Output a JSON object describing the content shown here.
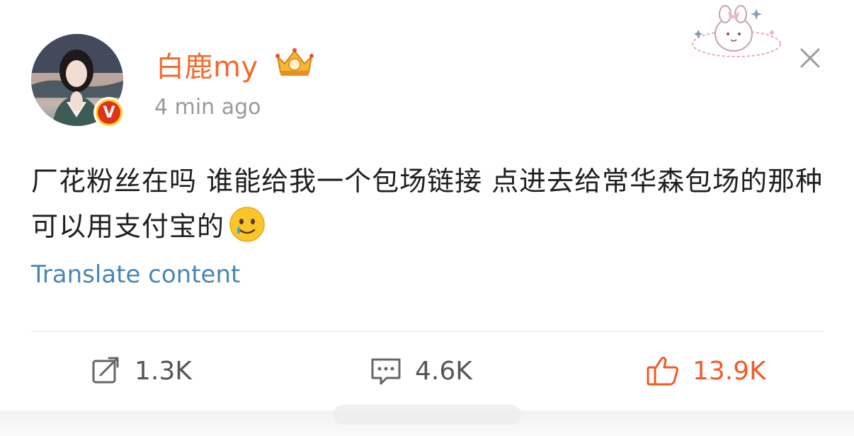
{
  "header": {
    "username": "白鹿my",
    "timestamp": "4 min ago"
  },
  "post": {
    "text": "厂花粉丝在吗 谁能给我一个包场链接 点进去给常华森包场的那种 可以用支付宝的",
    "translate_label": "Translate content"
  },
  "actions": {
    "repost_count": "1.3K",
    "comment_count": "4.6K",
    "like_count": "13.9K"
  },
  "colors": {
    "username": "#f36a2b",
    "link": "#4a86b5",
    "like_active": "#f15a24",
    "verified_badge": "#ffd21f"
  },
  "icons": [
    "verified-badge-icon",
    "crown-badge-icon",
    "close-icon",
    "crying-smile-emoji-icon",
    "repost-icon",
    "comment-icon",
    "like-icon"
  ]
}
